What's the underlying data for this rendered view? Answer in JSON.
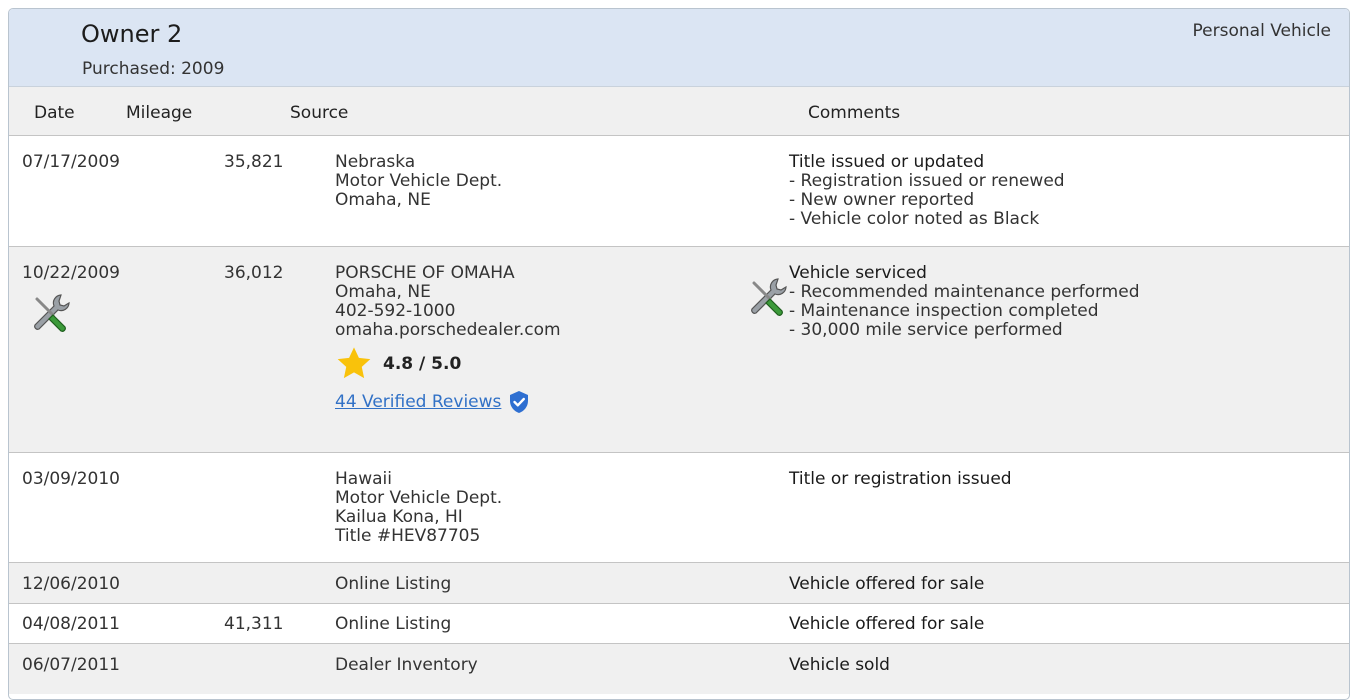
{
  "owner": {
    "title": "Owner 2",
    "purchased": "Purchased: 2009",
    "vehicle_type": "Personal Vehicle"
  },
  "columns": {
    "date": "Date",
    "mileage": "Mileage",
    "source": "Source",
    "comments": "Comments"
  },
  "rows": [
    {
      "date": "07/17/2009",
      "mileage": "35,821",
      "source": [
        "Nebraska",
        "Motor Vehicle Dept.",
        "Omaha, NE"
      ],
      "comment_title": "Title issued or updated",
      "comment_items": [
        "- Registration issued or renewed",
        "- New owner reported",
        "- Vehicle color noted as Black"
      ]
    },
    {
      "date": "10/22/2009",
      "mileage": "36,012",
      "source": [
        "PORSCHE OF OMAHA",
        "Omaha, NE",
        "402-592-1000",
        "omaha.porschedealer.com"
      ],
      "rating": "4.8 /  5.0",
      "reviews_link": "44 Verified Reviews",
      "comment_title": "Vehicle serviced",
      "comment_items": [
        "- Recommended maintenance performed",
        "- Maintenance inspection completed",
        "- 30,000 mile service performed"
      ]
    },
    {
      "date": "03/09/2010",
      "mileage": "",
      "source": [
        "Hawaii",
        "Motor Vehicle Dept.",
        "Kailua Kona, HI",
        "Title #HEV87705"
      ],
      "comment_title": "Title or registration issued",
      "comment_items": []
    },
    {
      "date": "12/06/2010",
      "mileage": "",
      "source": [
        "Online Listing"
      ],
      "comment_title": "Vehicle offered for sale",
      "comment_items": []
    },
    {
      "date": "04/08/2011",
      "mileage": "41,311",
      "source": [
        "Online Listing"
      ],
      "comment_title": "Vehicle offered for sale",
      "comment_items": []
    },
    {
      "date": "06/07/2011",
      "mileage": "",
      "source": [
        "Dealer Inventory"
      ],
      "comment_title": "Vehicle sold",
      "comment_items": []
    }
  ],
  "icons": {
    "service": "wrench-screwdriver-icon",
    "rating": "star-icon",
    "verified": "verified-shield-icon"
  },
  "colors": {
    "header_bg": "#dbe5f3",
    "alt_row_bg": "#f0f0f0",
    "link": "#3171c6",
    "star": "#f9c20b",
    "verified": "#2e6fd1"
  }
}
